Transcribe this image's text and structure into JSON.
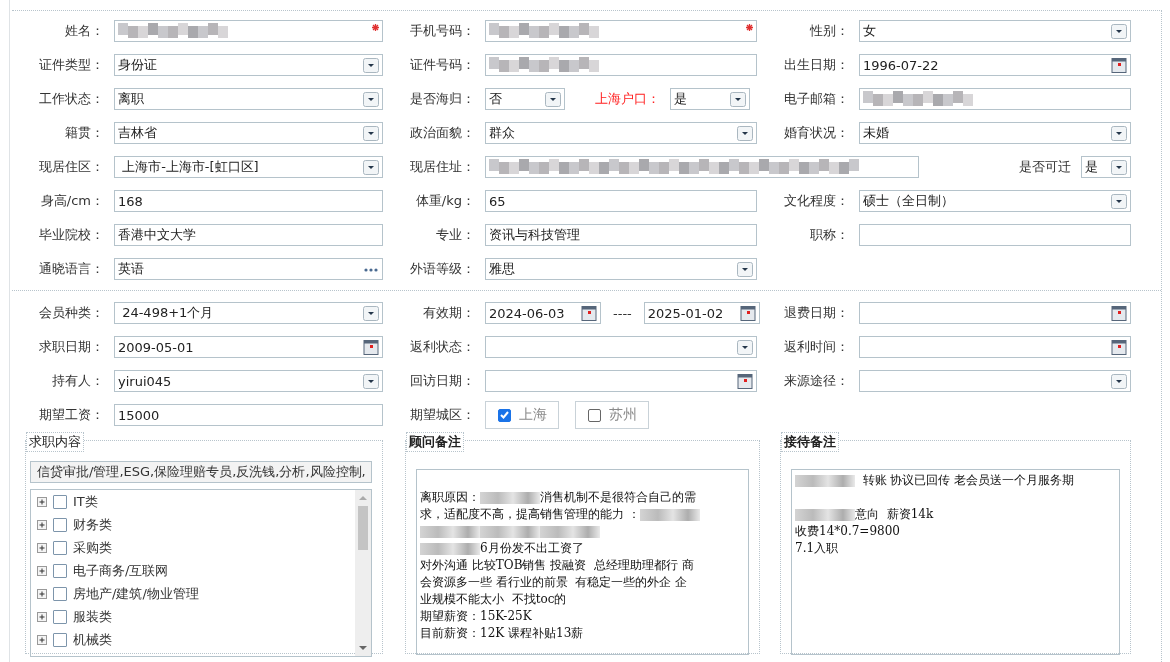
{
  "form_sections": [
    {
      "rows": [
        {
          "cells": [
            {
              "label": "姓名：",
              "fields": [
                {
                  "kind": "redacted",
                  "required": true
                }
              ]
            },
            {
              "label": "手机号码：",
              "fields": [
                {
                  "kind": "redacted",
                  "required": true
                }
              ]
            },
            {
              "label": "性别：",
              "fields": [
                {
                  "kind": "select",
                  "value": "女"
                }
              ]
            }
          ]
        },
        {
          "cells": [
            {
              "label": "证件类型：",
              "fields": [
                {
                  "kind": "select",
                  "value": "身份证"
                }
              ]
            },
            {
              "label": "证件号码：",
              "fields": [
                {
                  "kind": "redacted"
                }
              ]
            },
            {
              "label": "出生日期：",
              "fields": [
                {
                  "kind": "date",
                  "value": "1996-07-22"
                }
              ]
            }
          ]
        },
        {
          "cells": [
            {
              "label": "工作状态：",
              "fields": [
                {
                  "kind": "select",
                  "value": "离职"
                }
              ]
            },
            {
              "label": "是否海归：",
              "fields": [
                {
                  "kind": "select",
                  "value": "否"
                },
                {
                  "kind": "label",
                  "text": "上海户口：",
                  "highlight": true
                },
                {
                  "kind": "select",
                  "value": "是"
                }
              ]
            },
            {
              "label": "电子邮箱：",
              "fields": [
                {
                  "kind": "redacted"
                }
              ]
            }
          ]
        },
        {
          "cells": [
            {
              "label": "籍贯：",
              "fields": [
                {
                  "kind": "select",
                  "value": "吉林省"
                }
              ]
            },
            {
              "label": "政治面貌：",
              "fields": [
                {
                  "kind": "select",
                  "value": "群众"
                }
              ]
            },
            {
              "label": "婚育状况：",
              "fields": [
                {
                  "kind": "select",
                  "value": "未婚"
                }
              ]
            }
          ]
        },
        {
          "cells": [
            {
              "label": "现居住区：",
              "fields": [
                {
                  "kind": "select",
                  "value": " 上海市-上海市-[虹口区]"
                }
              ]
            },
            {
              "label": "现居住址：",
              "fields": [
                {
                  "kind": "redacted"
                },
                {
                  "kind": "label",
                  "text": "是否可迁",
                  "highlight": false
                },
                {
                  "kind": "select",
                  "value": "是"
                }
              ]
            }
          ]
        },
        {
          "cells": [
            {
              "label": "身高/cm：",
              "fields": [
                {
                  "kind": "text",
                  "value": "168"
                }
              ]
            },
            {
              "label": "体重/kg：",
              "fields": [
                {
                  "kind": "text",
                  "value": "65"
                }
              ]
            },
            {
              "label": "文化程度：",
              "fields": [
                {
                  "kind": "select",
                  "value": "硕士（全日制）"
                }
              ]
            }
          ]
        },
        {
          "cells": [
            {
              "label": "毕业院校：",
              "fields": [
                {
                  "kind": "text",
                  "value": "香港中文大学"
                }
              ]
            },
            {
              "label": "专业：",
              "fields": [
                {
                  "kind": "text",
                  "value": "资讯与科技管理"
                }
              ]
            },
            {
              "label": "职称：",
              "fields": [
                {
                  "kind": "text"
                }
              ]
            }
          ]
        },
        {
          "cells": [
            {
              "label": "通晓语言：",
              "fields": [
                {
                  "kind": "picker",
                  "value": "英语"
                }
              ]
            },
            {
              "label": "外语等级：",
              "fields": [
                {
                  "kind": "select",
                  "value": "雅思"
                }
              ]
            }
          ]
        }
      ]
    },
    {
      "rows": [
        {
          "cells": [
            {
              "label": "会员种类：",
              "fields": [
                {
                  "kind": "select",
                  "value": " 24-498+1个月"
                }
              ]
            },
            {
              "label": "有效期：",
              "fields": [
                {
                  "kind": "date",
                  "value": "2024-06-03"
                },
                {
                  "kind": "separator",
                  "text": "----"
                },
                {
                  "kind": "date",
                  "value": "2025-01-02"
                }
              ]
            },
            {
              "label": "退费日期：",
              "fields": [
                {
                  "kind": "date"
                }
              ]
            }
          ]
        },
        {
          "cells": [
            {
              "label": "求职日期：",
              "fields": [
                {
                  "kind": "date",
                  "value": "2009-05-01"
                }
              ]
            },
            {
              "label": "返利状态：",
              "fields": [
                {
                  "kind": "select"
                }
              ]
            },
            {
              "label": "返利时间：",
              "fields": [
                {
                  "kind": "date"
                }
              ]
            }
          ]
        },
        {
          "cells": [
            {
              "label": "持有人：",
              "fields": [
                {
                  "kind": "select",
                  "value": "yirui045"
                }
              ]
            },
            {
              "label": "回访日期：",
              "fields": [
                {
                  "kind": "date"
                }
              ]
            },
            {
              "label": "来源途径：",
              "fields": [
                {
                  "kind": "select"
                }
              ]
            }
          ]
        },
        {
          "cells": [
            {
              "label": "期望工资：",
              "fields": [
                {
                  "kind": "text",
                  "value": "15000"
                }
              ]
            },
            {
              "label": "期望城区：",
              "fields": [
                {
                  "kind": "checkbox",
                  "text": "上海",
                  "checked": true
                },
                {
                  "kind": "checkbox",
                  "text": "苏州",
                  "checked": false
                }
              ]
            }
          ]
        }
      ]
    }
  ],
  "job_content": {
    "title": "求职内容",
    "summary": "信贷审批/管理,ESG,保险理赔专员,反洗钱,分析,风险控制,",
    "tree": [
      {
        "label": "IT类",
        "expanded": false,
        "checked": false
      },
      {
        "label": "财务类",
        "expanded": false,
        "checked": false
      },
      {
        "label": "采购类",
        "expanded": false,
        "checked": false
      },
      {
        "label": "电子商务/互联网",
        "expanded": false,
        "checked": false
      },
      {
        "label": "房地产/建筑/物业管理",
        "expanded": false,
        "checked": false
      },
      {
        "label": "服装类",
        "expanded": false,
        "checked": false
      },
      {
        "label": "机械类",
        "expanded": false,
        "checked": false
      }
    ]
  },
  "consultant_notes": {
    "title": "顾问备注",
    "lines": [
      {
        "kind": "blank"
      },
      {
        "kind": "text",
        "segments": [
          {
            "kind": "text",
            "text": "离职原因："
          },
          {
            "kind": "redacted"
          },
          {
            "kind": "text",
            "text": "消售机制不是很符合自己的需"
          }
        ]
      },
      {
        "kind": "text",
        "segments": [
          {
            "kind": "text",
            "text": "求，适配度不高，提高销售管理的能力 ："
          },
          {
            "kind": "redacted"
          }
        ]
      },
      {
        "kind": "text",
        "segments": [
          {
            "kind": "redacted"
          },
          {
            "kind": "redacted"
          },
          {
            "kind": "redacted"
          }
        ]
      },
      {
        "kind": "text",
        "segments": [
          {
            "kind": "redacted"
          },
          {
            "kind": "text",
            "text": "6月份发不出工资了"
          }
        ]
      },
      {
        "kind": "text",
        "segments": [
          {
            "kind": "text",
            "text": "对外沟通 比较TOB销售 投融资  总经理助理都行 商"
          }
        ]
      },
      {
        "kind": "text",
        "segments": [
          {
            "kind": "text",
            "text": "会资源多一些 看行业的前景  有稳定一些的外企 企"
          }
        ]
      },
      {
        "kind": "text",
        "segments": [
          {
            "kind": "text",
            "text": "业规模不能太小  不找toc的"
          }
        ]
      },
      {
        "kind": "text",
        "segments": [
          {
            "kind": "text",
            "text": "期望薪资：15K-25K"
          }
        ]
      },
      {
        "kind": "text",
        "segments": [
          {
            "kind": "text",
            "text": "目前薪资：12K 课程补贴13薪"
          }
        ]
      }
    ]
  },
  "reception_notes": {
    "title": "接待备注",
    "lines": [
      {
        "kind": "text",
        "segments": [
          {
            "kind": "redacted"
          },
          {
            "kind": "text",
            "text": "  转账 协议已回传 老会员送一个月服务期"
          }
        ]
      },
      {
        "kind": "blank"
      },
      {
        "kind": "text",
        "segments": [
          {
            "kind": "redacted"
          },
          {
            "kind": "text",
            "text": "意向  薪资14k"
          }
        ]
      },
      {
        "kind": "text",
        "segments": [
          {
            "kind": "text",
            "text": "收费14*0.7=9800"
          }
        ]
      },
      {
        "kind": "text",
        "segments": [
          {
            "kind": "text",
            "text": "7.1入职"
          }
        ]
      }
    ]
  }
}
